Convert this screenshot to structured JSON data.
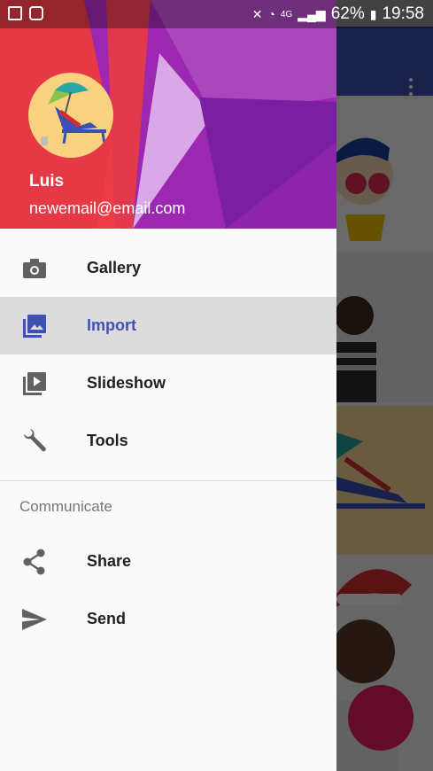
{
  "status_bar": {
    "battery_percent": "62%",
    "time": "19:58",
    "network": "4G"
  },
  "drawer": {
    "user": {
      "name": "Luis",
      "email": "newemail@email.com"
    },
    "items": [
      {
        "label": "Gallery",
        "icon": "camera-icon",
        "active": false
      },
      {
        "label": "Import",
        "icon": "photo-library-icon",
        "active": true
      },
      {
        "label": "Slideshow",
        "icon": "slideshow-icon",
        "active": false
      },
      {
        "label": "Tools",
        "icon": "wrench-icon",
        "active": false
      }
    ],
    "section_title": "Communicate",
    "section_items": [
      {
        "label": "Share",
        "icon": "share-icon"
      },
      {
        "label": "Send",
        "icon": "send-icon"
      }
    ]
  },
  "colors": {
    "primary": "#3f51b5",
    "accent": "#e91e63",
    "active_item_bg": "#dcdcdc"
  }
}
